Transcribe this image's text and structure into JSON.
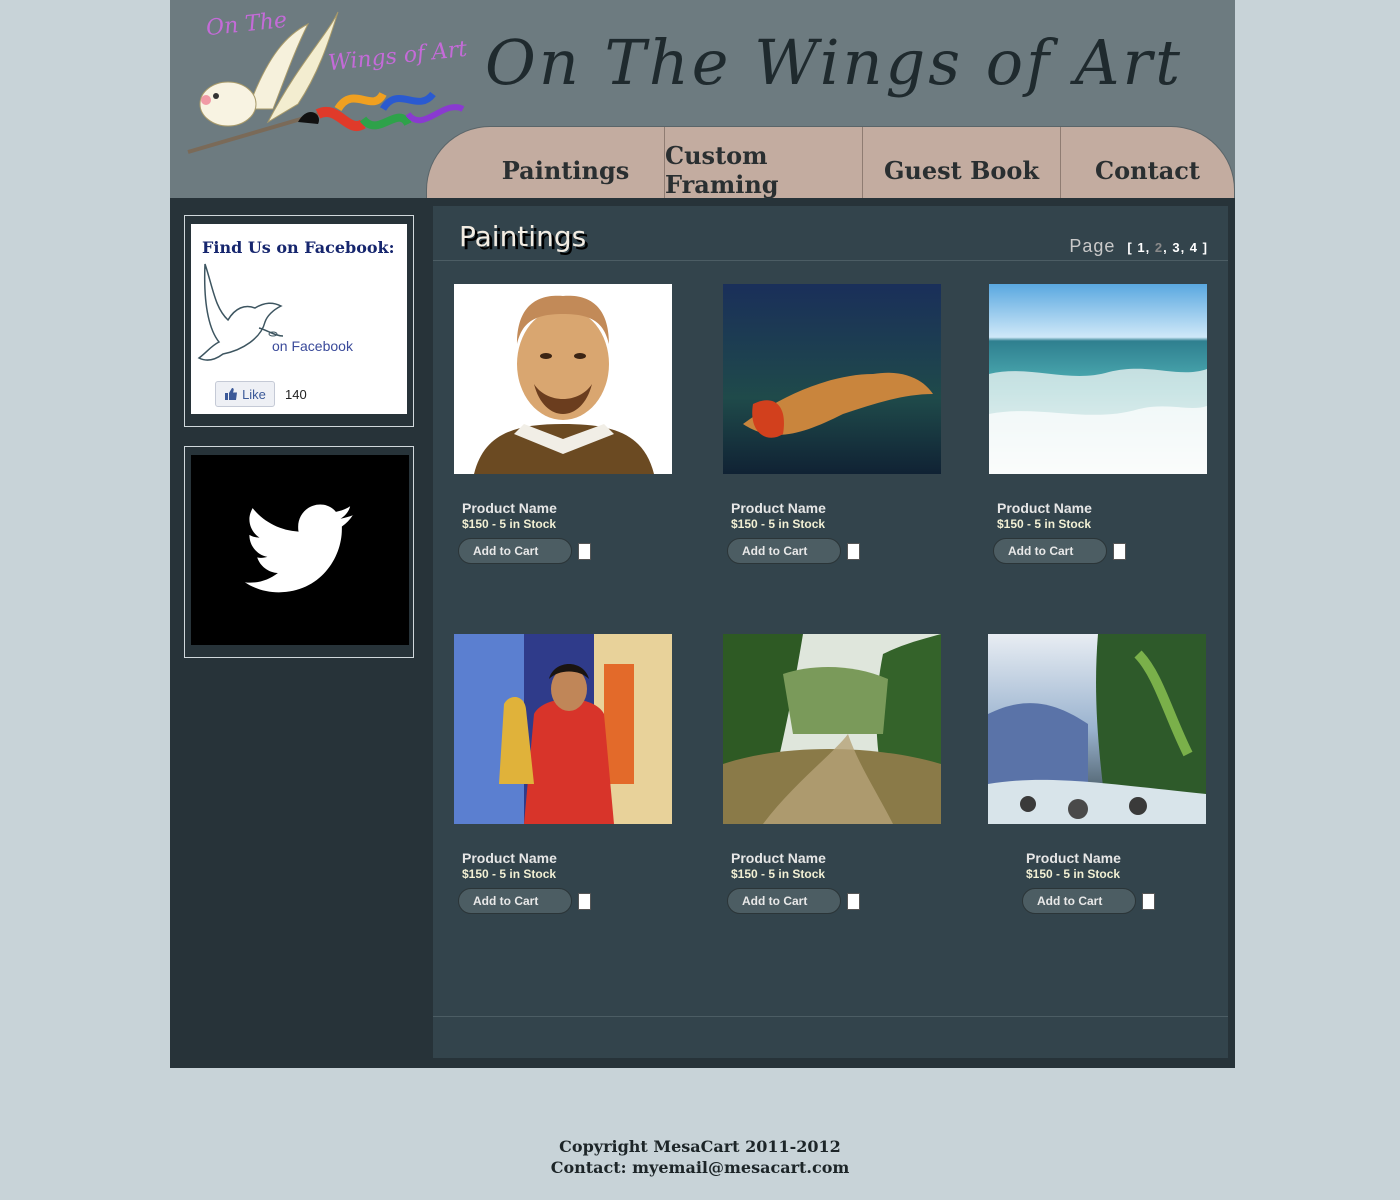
{
  "site": {
    "title": "On The Wings of Art",
    "logo_line1": "On The",
    "logo_line2": "Wings of Art"
  },
  "nav": [
    "Paintings",
    "Custom Framing",
    "Guest Book",
    "Contact"
  ],
  "sidebar": {
    "facebook": {
      "title": "Find Us on Facebook:",
      "subtitle": "on Facebook",
      "like_label": "Like",
      "like_count": "140",
      "icon": "dove-icon"
    },
    "twitter": {
      "icon": "twitter-bird-icon",
      "background": "#000000"
    }
  },
  "main": {
    "page_title": "Paintings",
    "pager_label": "Page",
    "pager_open": "[",
    "pages": [
      "1",
      "2",
      "3",
      "4"
    ],
    "current_page": "2",
    "pager_close": "]"
  },
  "products": [
    {
      "name": "Product Name",
      "price": "$150 - 5 in Stock",
      "button": "Add to Cart",
      "image": "shakespeare-portrait"
    },
    {
      "name": "Product Name",
      "price": "$150 - 5 in Stock",
      "button": "Add to Cart",
      "image": "reclining-figure"
    },
    {
      "name": "Product Name",
      "price": "$150 - 5 in Stock",
      "button": "Add to Cart",
      "image": "ocean-waves"
    },
    {
      "name": "Product Name",
      "price": "$150 - 5 in Stock",
      "button": "Add to Cart",
      "image": "woman-in-red"
    },
    {
      "name": "Product Name",
      "price": "$150 - 5 in Stock",
      "button": "Add to Cart",
      "image": "forest-river"
    },
    {
      "name": "Product Name",
      "price": "$150 - 5 in Stock",
      "button": "Add to Cart",
      "image": "mountain-stream"
    }
  ],
  "footer": {
    "copyright": "Copyright MesaCart 2011-2012",
    "contact": "Contact:  myemail@mesacart.com"
  },
  "colors": {
    "page_bg": "#c8d3d8",
    "header_bg": "#6d7b80",
    "nav_bg": "#c3aca0",
    "main_bg": "#33444c",
    "sidebar_bg": "#273339"
  }
}
